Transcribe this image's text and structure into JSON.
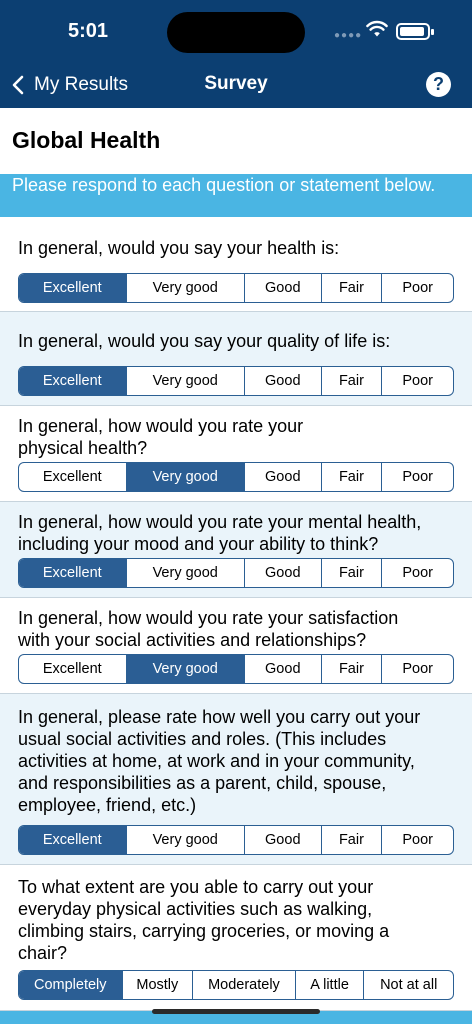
{
  "status": {
    "time": "5:01"
  },
  "nav": {
    "back_label": "My Results",
    "title": "Survey",
    "help_label": "?"
  },
  "section_title": "Global Health",
  "instruction": "Please respond to each question or statement below.",
  "questions": [
    {
      "lines": [
        "In general, would you say your health is:"
      ],
      "options": [
        "Excellent",
        "Very good",
        "Good",
        "Fair",
        "Poor"
      ],
      "selected": "Excellent"
    },
    {
      "lines": [
        "In general, would you say your quality of life is:"
      ],
      "options": [
        "Excellent",
        "Very good",
        "Good",
        "Fair",
        "Poor"
      ],
      "selected": "Excellent"
    },
    {
      "lines": [
        "In general, how would you rate your",
        "physical health?"
      ],
      "options": [
        "Excellent",
        "Very good",
        "Good",
        "Fair",
        "Poor"
      ],
      "selected": "Very good"
    },
    {
      "lines": [
        "In general, how would you rate your mental health,",
        "including your mood and your ability to think?"
      ],
      "options": [
        "Excellent",
        "Very good",
        "Good",
        "Fair",
        "Poor"
      ],
      "selected": "Excellent"
    },
    {
      "lines": [
        "In general, how would you rate your satisfaction",
        "with your social activities and relationships?"
      ],
      "options": [
        "Excellent",
        "Very good",
        "Good",
        "Fair",
        "Poor"
      ],
      "selected": "Very good"
    },
    {
      "lines": [
        "In general, please rate how well you carry out your",
        "usual social activities and roles. (This includes",
        "activities at home, at work and in your community,",
        "and responsibilities as a parent, child, spouse,",
        "employee, friend, etc.)"
      ],
      "options": [
        "Excellent",
        "Very good",
        "Good",
        "Fair",
        "Poor"
      ],
      "selected": "Excellent"
    },
    {
      "lines": [
        "To what extent are you able to carry out your",
        "everyday physical activities such as walking,",
        "climbing stairs, carrying groceries, or moving a",
        "chair?"
      ],
      "options": [
        "Completely",
        "Mostly",
        "Moderately",
        "A little",
        "Not at all"
      ],
      "selected": "Completely"
    }
  ],
  "colors": {
    "header_bg": "#0c3f72",
    "banner_bg": "#4ab5e3",
    "selected_bg": "#2b5e94",
    "tinted_card_bg": "#eaf4fa"
  },
  "icons": [
    "wifi-icon",
    "battery-icon",
    "chevron-left-icon",
    "help-icon"
  ]
}
